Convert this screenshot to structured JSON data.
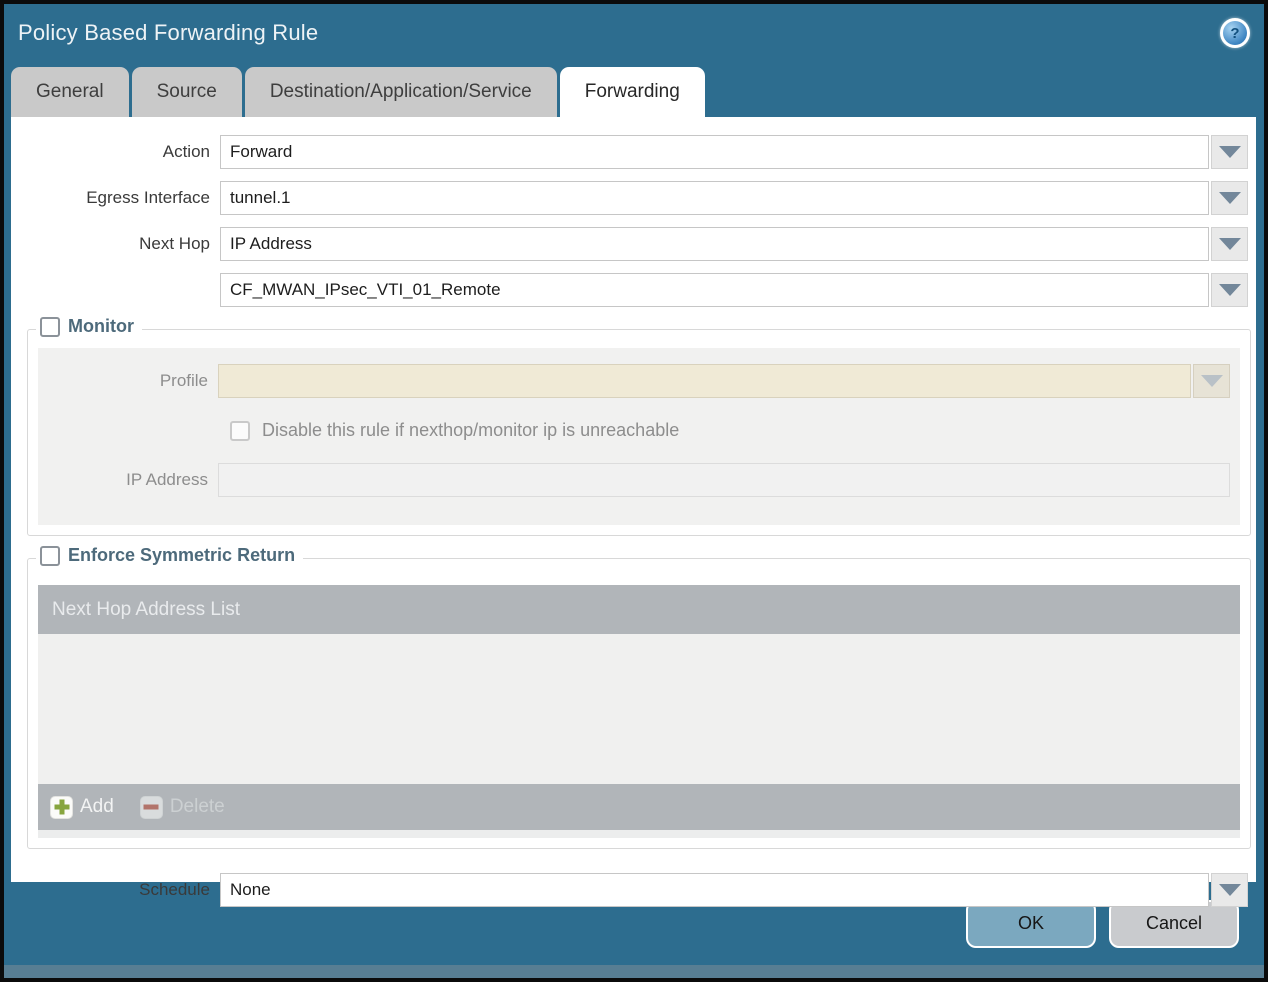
{
  "dialog": {
    "title": "Policy Based Forwarding Rule",
    "help_glyph": "?"
  },
  "tabs": [
    {
      "label": "General",
      "active": false
    },
    {
      "label": "Source",
      "active": false
    },
    {
      "label": "Destination/Application/Service",
      "active": false
    },
    {
      "label": "Forwarding",
      "active": true
    }
  ],
  "form": {
    "action": {
      "label": "Action",
      "value": "Forward"
    },
    "egress_interface": {
      "label": "Egress Interface",
      "value": "tunnel.1"
    },
    "next_hop": {
      "label": "Next Hop",
      "value": "IP Address"
    },
    "next_hop_address": {
      "value": "CF_MWAN_IPsec_VTI_01_Remote"
    },
    "schedule": {
      "label": "Schedule",
      "value": "None"
    }
  },
  "monitor": {
    "legend": "Monitor",
    "checked": false,
    "profile": {
      "label": "Profile",
      "value": ""
    },
    "disable_rule_label": "Disable this rule if nexthop/monitor ip is unreachable",
    "disable_rule_checked": false,
    "ip_address": {
      "label": "IP Address",
      "value": ""
    }
  },
  "enforce_symmetric_return": {
    "legend": "Enforce Symmetric Return",
    "checked": false,
    "list_header": "Next Hop Address List",
    "rows": [],
    "add_label": "Add",
    "delete_label": "Delete",
    "delete_enabled": false
  },
  "footer": {
    "ok_label": "OK",
    "cancel_label": "Cancel"
  },
  "colors": {
    "dialog_teal": "#2d6d8f",
    "active_tab_bg": "#ffffff",
    "inactive_tab_bg": "#c9c9c9",
    "section_legend_text": "#4d6a7b",
    "grid_chrome": "#b1b5b9",
    "disabled_field_beige": "#f0ead6",
    "ok_button_bg": "#7ba8bf",
    "cancel_button_bg": "#c9cbce",
    "add_icon_green": "#87a53e",
    "delete_icon_red": "#b2746b"
  }
}
